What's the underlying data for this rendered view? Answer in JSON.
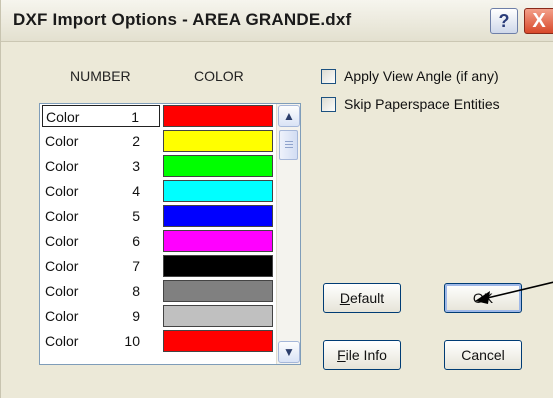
{
  "window": {
    "title": "DXF Import Options - AREA GRANDE.dxf"
  },
  "titlebar": {
    "help_label": "?",
    "close_label": "X"
  },
  "table": {
    "header_number": "NUMBER",
    "header_color": "COLOR",
    "rows": [
      {
        "label": "Color",
        "number": "1",
        "color": "#ff0000"
      },
      {
        "label": "Color",
        "number": "2",
        "color": "#ffff00"
      },
      {
        "label": "Color",
        "number": "3",
        "color": "#00ff00"
      },
      {
        "label": "Color",
        "number": "4",
        "color": "#00ffff"
      },
      {
        "label": "Color",
        "number": "5",
        "color": "#0000ff"
      },
      {
        "label": "Color",
        "number": "6",
        "color": "#ff00ff"
      },
      {
        "label": "Color",
        "number": "7",
        "color": "#000000"
      },
      {
        "label": "Color",
        "number": "8",
        "color": "#808080"
      },
      {
        "label": "Color",
        "number": "9",
        "color": "#c0c0c0"
      },
      {
        "label": "Color",
        "number": "10",
        "color": "#ff0000"
      }
    ],
    "selected_index": 0
  },
  "options": {
    "apply_view_angle": {
      "label": "Apply View Angle (if any)",
      "checked": false
    },
    "skip_paperspace": {
      "label": "Skip Paperspace Entities",
      "checked": false
    }
  },
  "buttons": {
    "default": {
      "label": "Default",
      "accel": "D",
      "rest": "efault"
    },
    "ok": {
      "label": "OK"
    },
    "file_info": {
      "label": "File Info",
      "accel": "F",
      "rest": "ile Info"
    },
    "cancel": {
      "label": "Cancel"
    }
  }
}
